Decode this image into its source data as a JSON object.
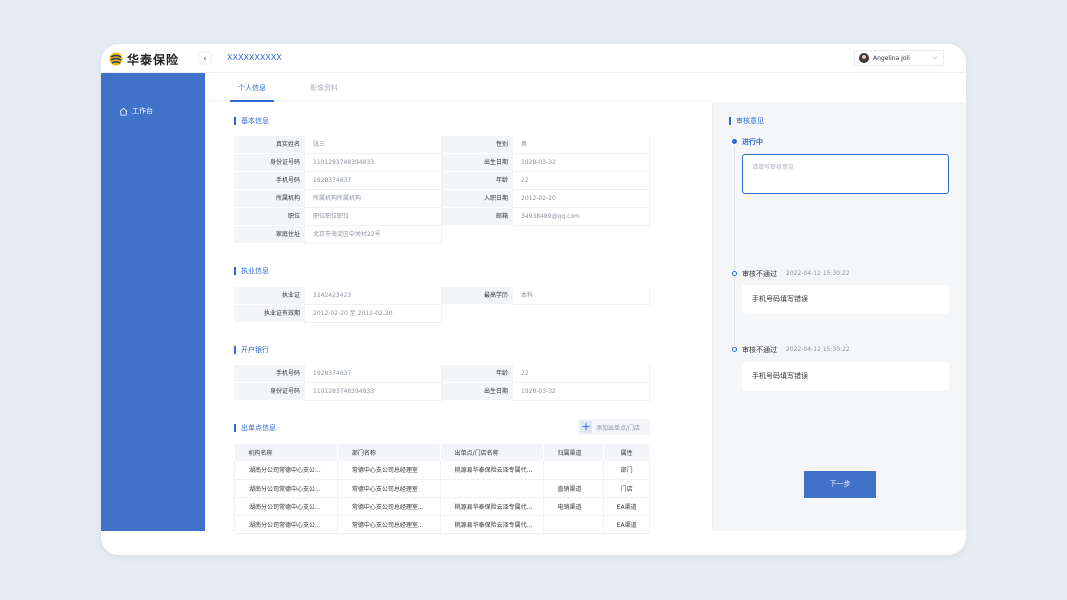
{
  "header": {
    "logo_text": "华泰保险",
    "collapse_icon": "‹",
    "breadcrumb": "XXXXXXXXXX",
    "user_name": "Angelina Joli",
    "user_chevron": "⌵"
  },
  "sidebar": {
    "items": [
      {
        "label": "工作台",
        "icon": "home-icon"
      }
    ]
  },
  "tabs": [
    {
      "label": "个人信息",
      "active": true
    },
    {
      "label": "影像资料",
      "active": false
    }
  ],
  "basic_info": {
    "title": "基本信息",
    "rows": [
      {
        "l1": "真实姓名",
        "v1": "张三",
        "l2": "性别",
        "v2": "男"
      },
      {
        "l1": "身份证号码",
        "v1": "1101283748394833",
        "l2": "出生日期",
        "v2": "1928-03-32"
      },
      {
        "l1": "手机号码",
        "v1": "1928374637",
        "l2": "年龄",
        "v2": "22"
      },
      {
        "l1": "所属机构",
        "v1": "所属机构所属机构",
        "l2": "入职日期",
        "v2": "2012-02-20"
      },
      {
        "l1": "职位",
        "v1": "职位职位职位",
        "l2": "邮箱",
        "v2": "34938489@qq.com"
      },
      {
        "l1": "家庭住址",
        "v1": "北京市海淀区中关村22号"
      }
    ]
  },
  "practice_info": {
    "title": "执业信息",
    "rows": [
      {
        "l1": "执业证",
        "v1": "3242423423",
        "l2": "最高学历",
        "v2": "本科"
      },
      {
        "l1": "执业证有效期",
        "v1": "2012-02-20 至 2012-02-20"
      }
    ]
  },
  "bank_info": {
    "title": "开户银行",
    "rows": [
      {
        "l1": "手机号码",
        "v1": "1928374637",
        "l2": "年龄",
        "v2": "22"
      },
      {
        "l1": "身份证号码",
        "v1": "1101283748394833",
        "l2": "出生日期",
        "v2": "1928-03-32"
      }
    ]
  },
  "outlets": {
    "title": "出单点信息",
    "add_label": "添加出单点/门店",
    "add_icon": "+",
    "columns": [
      "机构名称",
      "部门名称",
      "出单点/门店名称",
      "归属渠道",
      "属性"
    ],
    "rows": [
      [
        "湖南分公司常德中心支公...",
        "常德中心支公司总经理室",
        "桃源县华泰保险云泽专属代...",
        "",
        "部门"
      ],
      [
        "湖南分公司常德中心支公...",
        "常德中心支公司总经理室",
        "",
        "直销渠道",
        "门店"
      ],
      [
        "湖南分公司常德中心支公...",
        "常德中心支公司总经理室...",
        "桃源县华泰保险云泽专属代...",
        "电销渠道",
        "EA渠道"
      ],
      [
        "湖南分公司常德中心支公...",
        "常德中心支公司总经理室...",
        "桃源县华泰保险云泽专属代...",
        "",
        "EA渠道"
      ]
    ]
  },
  "review": {
    "title": "审核意见",
    "current_status": "进行中",
    "textarea_placeholder": "请填写审核意见",
    "history": [
      {
        "status": "审核不通过",
        "time": "2022-04-12 15:30:22",
        "comment": "手机号码填写错误"
      },
      {
        "status": "审核不通过",
        "time": "2022-04-12 15:30:22",
        "comment": "手机号码填写错误"
      }
    ],
    "next_label": "下一步"
  },
  "colors": {
    "accent": "#2f6ad6",
    "sidebar": "#3f72c8",
    "page_bg": "#e6eaf1"
  }
}
